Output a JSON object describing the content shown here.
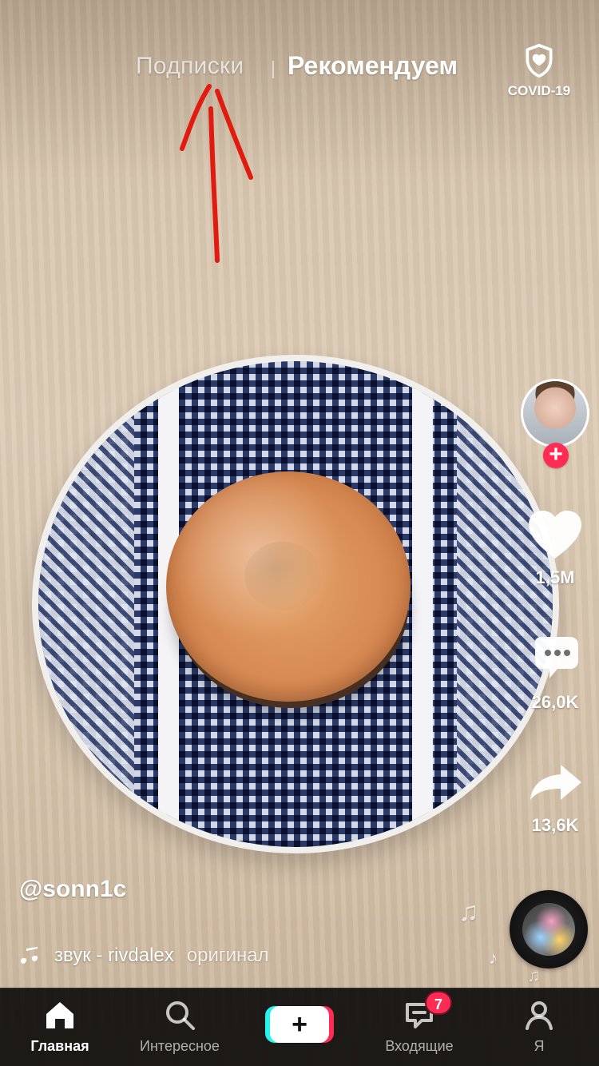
{
  "top_nav": {
    "following_label": "Подписки",
    "for_you_label": "Рекомендуем",
    "covid_label": "COVID-19"
  },
  "right_rail": {
    "like_count": "1,5M",
    "comment_count": "26,0K",
    "share_count": "13,6K",
    "follow_plus": "+"
  },
  "caption": {
    "username": "@sonn1c",
    "music_left": "звук - rivdalex",
    "music_right": "оригинал"
  },
  "tabbar": {
    "home_label": "Главная",
    "discover_label": "Интересное",
    "create_symbol": "+",
    "inbox_label": "Входящие",
    "me_label": "Я",
    "inbox_badge": "7"
  },
  "colors": {
    "accent_pink": "#fe2c55",
    "accent_cyan": "#25f4ee",
    "annotation_red": "#e11b0f"
  },
  "icons": {
    "covid": "shield-heart-icon",
    "like": "heart-icon",
    "comment": "comment-bubble-icon",
    "share": "share-arrow-icon",
    "music": "music-note-icon",
    "home": "home-icon",
    "discover": "search-icon",
    "create": "create-plus-icon",
    "inbox": "inbox-icon",
    "me": "user-icon"
  }
}
